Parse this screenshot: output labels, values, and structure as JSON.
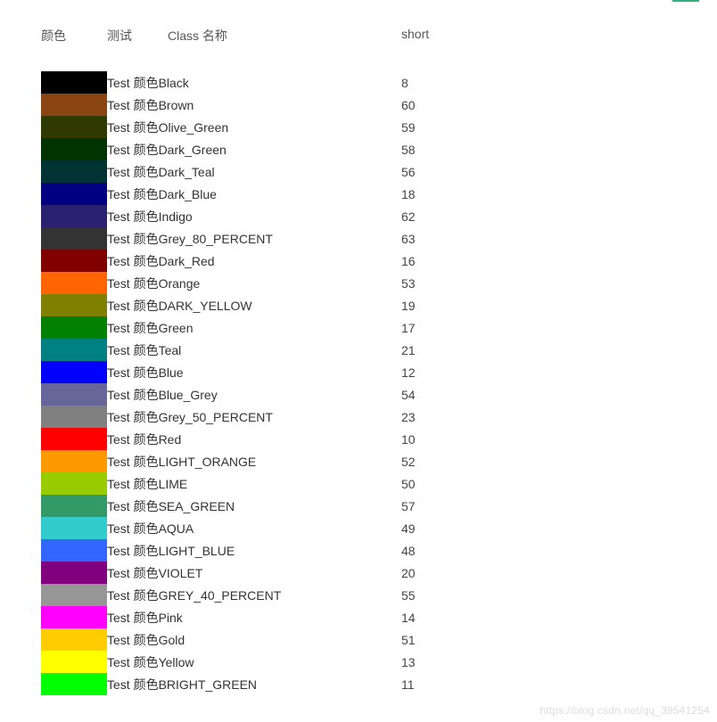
{
  "header": {
    "color": "颜色",
    "test": "测试",
    "class": "Class 名称",
    "short": "short"
  },
  "label_prefix": "Test 颜色",
  "rows": [
    {
      "name": "Black",
      "short": "8",
      "hex": "#000000"
    },
    {
      "name": "Brown",
      "short": "60",
      "hex": "#8b4513"
    },
    {
      "name": "Olive_Green",
      "short": "59",
      "hex": "#2f3b00"
    },
    {
      "name": "Dark_Green",
      "short": "58",
      "hex": "#003300"
    },
    {
      "name": "Dark_Teal",
      "short": "56",
      "hex": "#003333"
    },
    {
      "name": "Dark_Blue",
      "short": "18",
      "hex": "#000080"
    },
    {
      "name": "Indigo",
      "short": "62",
      "hex": "#2a2270"
    },
    {
      "name": "Grey_80_PERCENT",
      "short": "63",
      "hex": "#333333"
    },
    {
      "name": "Dark_Red",
      "short": "16",
      "hex": "#800000"
    },
    {
      "name": "Orange",
      "short": "53",
      "hex": "#ff6600"
    },
    {
      "name": "DARK_YELLOW",
      "short": "19",
      "hex": "#808000"
    },
    {
      "name": "Green",
      "short": "17",
      "hex": "#008000"
    },
    {
      "name": "Teal",
      "short": "21",
      "hex": "#008080"
    },
    {
      "name": "Blue",
      "short": "12",
      "hex": "#0000ff"
    },
    {
      "name": "Blue_Grey",
      "short": "54",
      "hex": "#666699"
    },
    {
      "name": "Grey_50_PERCENT",
      "short": "23",
      "hex": "#808080"
    },
    {
      "name": "Red",
      "short": "10",
      "hex": "#ff0000"
    },
    {
      "name": "LIGHT_ORANGE",
      "short": "52",
      "hex": "#ff9900"
    },
    {
      "name": "LIME",
      "short": "50",
      "hex": "#99cc00"
    },
    {
      "name": "SEA_GREEN",
      "short": "57",
      "hex": "#339966"
    },
    {
      "name": "AQUA",
      "short": "49",
      "hex": "#33cccc"
    },
    {
      "name": "LIGHT_BLUE",
      "short": "48",
      "hex": "#3366ff"
    },
    {
      "name": "VIOLET",
      "short": "20",
      "hex": "#800080"
    },
    {
      "name": "GREY_40_PERCENT",
      "short": "55",
      "hex": "#969696"
    },
    {
      "name": "Pink",
      "short": "14",
      "hex": "#ff00ff"
    },
    {
      "name": "Gold",
      "short": "51",
      "hex": "#ffcc00"
    },
    {
      "name": "Yellow",
      "short": "13",
      "hex": "#ffff00"
    },
    {
      "name": "BRIGHT_GREEN",
      "short": "11",
      "hex": "#00ff00"
    }
  ],
  "watermark": "https://blog.csdn.net/qq_39541254"
}
